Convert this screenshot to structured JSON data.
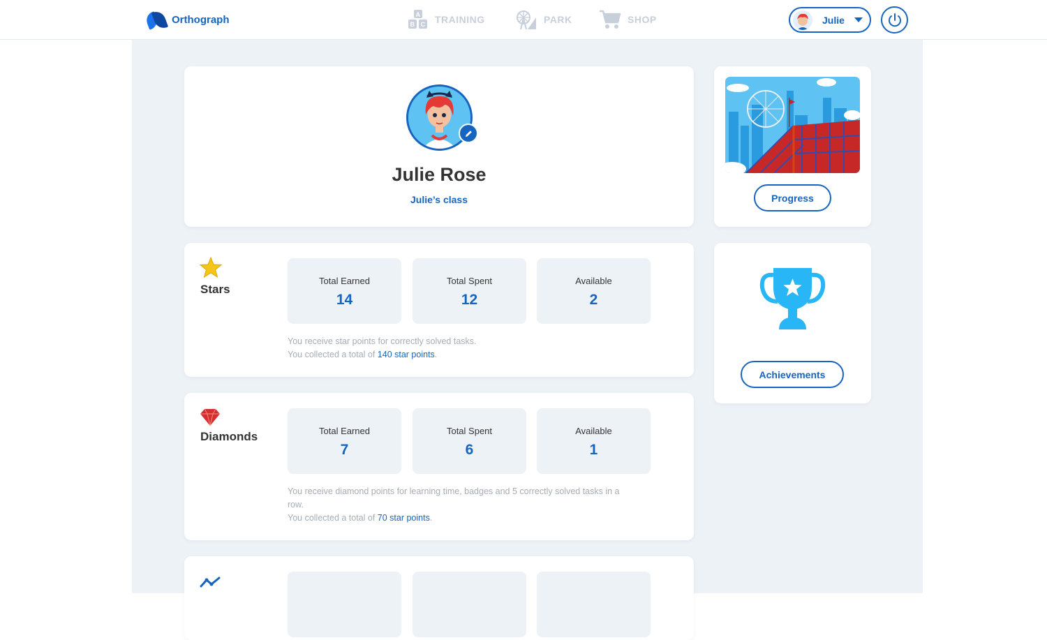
{
  "app": {
    "name": "Orthograph"
  },
  "nav": [
    {
      "label": "TRAINING",
      "icon": "abc-blocks-icon"
    },
    {
      "label": "PARK",
      "icon": "ferris-wheel-icon"
    },
    {
      "label": "SHOP",
      "icon": "cart-icon"
    }
  ],
  "user": {
    "name": "Julie"
  },
  "profile": {
    "full_name": "Julie Rose",
    "class_name": "Julie’s class"
  },
  "stars": {
    "title": "Stars",
    "stats": [
      {
        "label": "Total Earned",
        "value": "14"
      },
      {
        "label": "Total Spent",
        "value": "12"
      },
      {
        "label": "Available",
        "value": "2"
      }
    ],
    "note_line1": "You receive star points for correctly solved tasks.",
    "note_prefix": "You collected a total of ",
    "note_highlight": "140 star points",
    "note_suffix": "."
  },
  "diamonds": {
    "title": "Diamonds",
    "stats": [
      {
        "label": "Total Earned",
        "value": "7"
      },
      {
        "label": "Total Spent",
        "value": "6"
      },
      {
        "label": "Available",
        "value": "1"
      }
    ],
    "note_line1": "You receive diamond points for learning time, badges and 5 correctly solved tasks in a row.",
    "note_prefix": "You collected a total of ",
    "note_highlight": "70 star points",
    "note_suffix": "."
  },
  "sidebar": {
    "progress_label": "Progress",
    "achievements_label": "Achievements"
  },
  "colors": {
    "accent": "#1565c0",
    "background": "#edf2f7",
    "star": "#f5c518",
    "diamond": "#d32f2f"
  }
}
